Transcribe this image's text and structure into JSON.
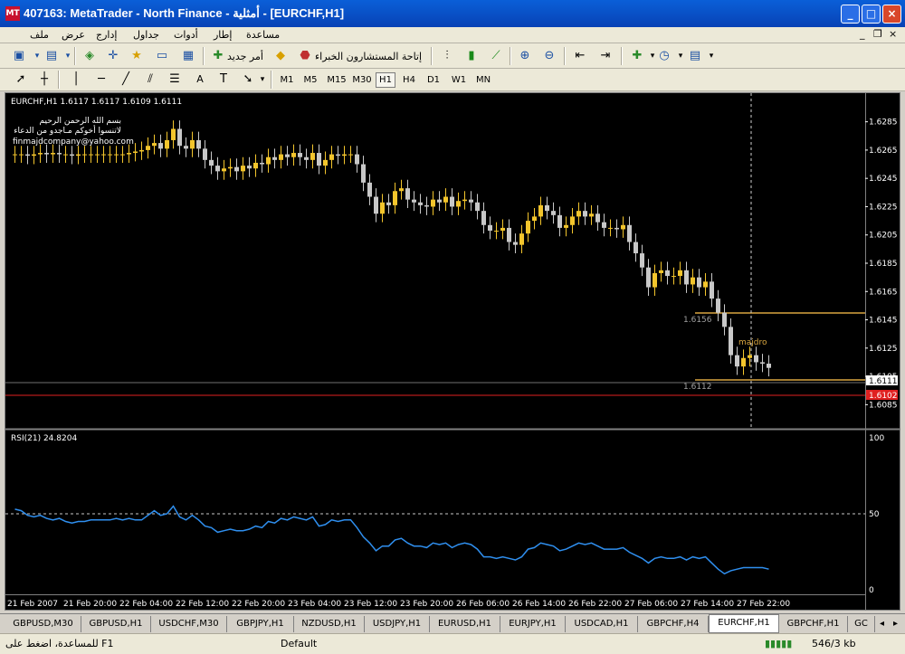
{
  "window": {
    "title": "407163: MetaTrader - North Finance - أمثلية - [EURCHF,H1]",
    "icon_text": "MT",
    "minimize": "_",
    "maximize": "□",
    "close": "×"
  },
  "menu": {
    "items": [
      "ملف",
      "عرض",
      "إدارج",
      "جداول",
      "أدوات",
      "إطار",
      "مساعدة"
    ],
    "mdi_minimize": "_",
    "mdi_restore": "❐",
    "mdi_close": "×"
  },
  "toolbar": {
    "new_order_label": "أمر جديد",
    "expert_advisors_label": "إتاحة المستشارون الخبراء",
    "timeframes": [
      "M1",
      "M5",
      "M15",
      "M30",
      "H1",
      "H4",
      "D1",
      "W1",
      "MN"
    ],
    "active_timeframe": "H1"
  },
  "chart": {
    "header": "EURCHF,H1  1.6117 1.6117 1.6109 1.6111",
    "overlay_text": [
      "بسم الله الرحمن الرحيم",
      "لاتنسوا أخوكم مـاجدو من الدعاء",
      "finmajdcompany@yahoo.com"
    ],
    "label_upper_line": "1.6156",
    "label_lower_line": "1.6112",
    "label_cursor": "majdro",
    "price_axis": [
      "1.6285",
      "1.6265",
      "1.6245",
      "1.6225",
      "1.6205",
      "1.6185",
      "1.6165",
      "1.6145",
      "1.6125",
      "1.6105",
      "1.6085"
    ],
    "current_price": "1.6111",
    "red_line_price": "1.6102",
    "hidden_tick": "1.6105",
    "time_axis": [
      "21 Feb 2007",
      "21 Feb 20:00",
      "22 Feb 04:00",
      "22 Feb 12:00",
      "22 Feb 20:00",
      "23 Feb 04:00",
      "23 Feb 12:00",
      "23 Feb 20:00",
      "26 Feb 06:00",
      "26 Feb 14:00",
      "26 Feb 22:00",
      "27 Feb 06:00",
      "27 Feb 14:00",
      "27 Feb 22:00"
    ],
    "colors": {
      "bull": "#f3c52c",
      "bear": "#c8c8c8",
      "rsi": "#2f8fef",
      "red_line": "#e02020",
      "level_line": "#d9a640"
    }
  },
  "indicator": {
    "header": "RSI(21) 24.8204",
    "axis": [
      "100",
      "50",
      "0"
    ]
  },
  "chart_data": {
    "type": "candlestick",
    "title": "EURCHF,H1",
    "x_range": [
      "21 Feb 2007",
      "27 Feb 22:00"
    ],
    "ylim": [
      1.6075,
      1.6295
    ],
    "close_series": [
      1.6262,
      1.6262,
      1.6261,
      1.6262,
      1.6263,
      1.6262,
      1.6263,
      1.6262,
      1.6262,
      1.6261,
      1.6262,
      1.6262,
      1.6262,
      1.6262,
      1.6262,
      1.6262,
      1.6262,
      1.6262,
      1.6263,
      1.6264,
      1.6265,
      1.6268,
      1.627,
      1.6266,
      1.6272,
      1.628,
      1.6268,
      1.6266,
      1.6272,
      1.6266,
      1.6258,
      1.6254,
      1.625,
      1.6252,
      1.6253,
      1.625,
      1.6254,
      1.6252,
      1.6256,
      1.6255,
      1.626,
      1.6258,
      1.6262,
      1.626,
      1.6263,
      1.626,
      1.6258,
      1.6263,
      1.6254,
      1.6258,
      1.6262,
      1.6261,
      1.6262,
      1.6262,
      1.6255,
      1.6242,
      1.6232,
      1.622,
      1.6228,
      1.6226,
      1.6236,
      1.6238,
      1.623,
      1.6228,
      1.6226,
      1.6225,
      1.623,
      1.6228,
      1.6232,
      1.6225,
      1.6229,
      1.623,
      1.6228,
      1.6222,
      1.6212,
      1.6208,
      1.6208,
      1.621,
      1.62,
      1.6198,
      1.6206,
      1.6215,
      1.6218,
      1.6226,
      1.6222,
      1.6219,
      1.621,
      1.6212,
      1.6218,
      1.6222,
      1.6218,
      1.622,
      1.6214,
      1.621,
      1.621,
      1.6209,
      1.6212,
      1.62,
      1.6192,
      1.6182,
      1.6168,
      1.6178,
      1.618,
      1.6176,
      1.6176,
      1.618,
      1.617,
      1.6175,
      1.6168,
      1.6172,
      1.616,
      1.615,
      1.614,
      1.612,
      1.6112,
      1.6118,
      1.612,
      1.6115,
      1.6114,
      1.6111
    ],
    "series": [
      {
        "name": "RSI(21)",
        "values": [
          53,
          52,
          49,
          48,
          49,
          47,
          46,
          47,
          45,
          44,
          45,
          45,
          46,
          46,
          46,
          46,
          47,
          46,
          47,
          46,
          46,
          49,
          52,
          49,
          50,
          55,
          48,
          46,
          49,
          46,
          42,
          41,
          38,
          39,
          40,
          39,
          39,
          40,
          42,
          41,
          45,
          44,
          47,
          46,
          48,
          47,
          46,
          48,
          42,
          43,
          46,
          45,
          46,
          46,
          41,
          35,
          31,
          26,
          29,
          29,
          33,
          34,
          31,
          29,
          29,
          28,
          31,
          30,
          31,
          28,
          30,
          31,
          30,
          27,
          22,
          22,
          21,
          22,
          21,
          20,
          22,
          27,
          28,
          31,
          30,
          29,
          26,
          27,
          29,
          31,
          30,
          31,
          29,
          27,
          27,
          27,
          28,
          25,
          23,
          21,
          18,
          21,
          22,
          21,
          21,
          22,
          20,
          22,
          21,
          22,
          18,
          14,
          11,
          13,
          14,
          15,
          15,
          15,
          15,
          14
        ]
      }
    ],
    "rsi_ylim": [
      0,
      100
    ],
    "rsi_level": 50
  }
}
